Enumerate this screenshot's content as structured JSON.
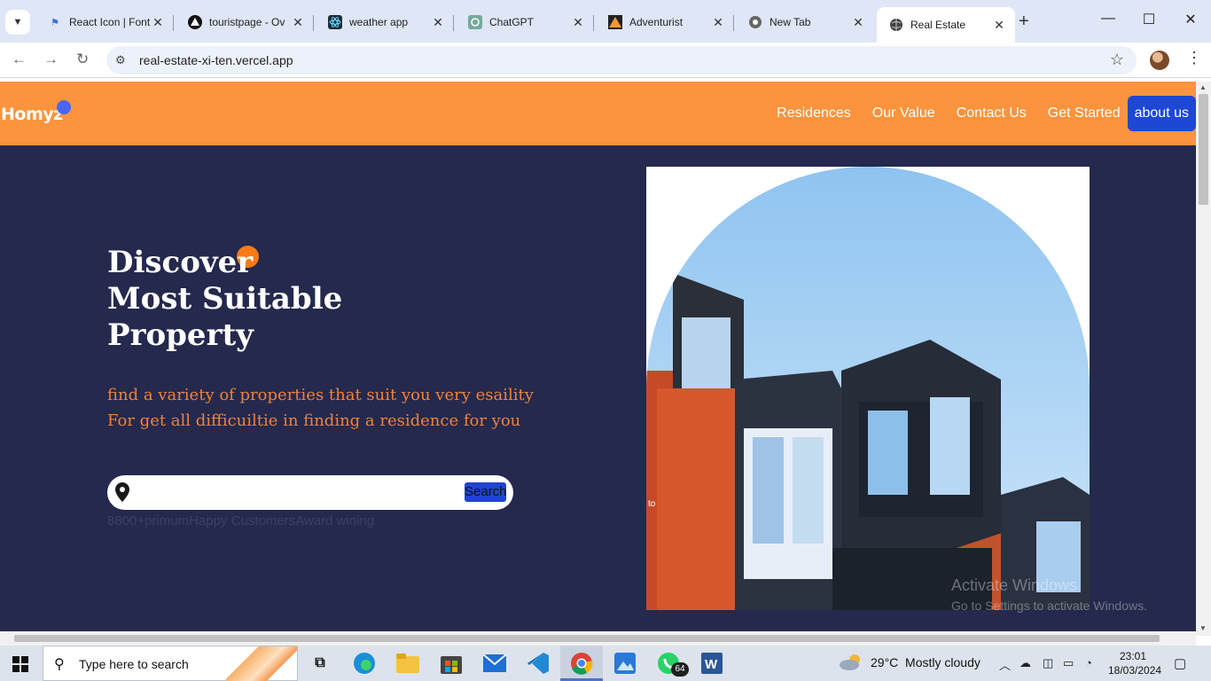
{
  "browser": {
    "tabs": [
      {
        "label": "React Icon | Font",
        "icon": "flag-icon",
        "active": false
      },
      {
        "label": "touristpage - Ov",
        "icon": "vercel-triangle-icon",
        "active": false
      },
      {
        "label": "weather app",
        "icon": "react-icon",
        "active": false
      },
      {
        "label": "ChatGPT",
        "icon": "chatgpt-icon",
        "active": false
      },
      {
        "label": "Adventurist",
        "icon": "mountain-icon",
        "active": false
      },
      {
        "label": "New Tab",
        "icon": "chrome-icon",
        "active": false
      },
      {
        "label": "Real Estate",
        "icon": "globe-icon",
        "active": true
      }
    ],
    "url": "real-estate-xi-ten.vercel.app"
  },
  "site": {
    "logo": "Homyz",
    "nav": {
      "residences": "Residences",
      "our_value": "Our Value",
      "contact_us": "Contact Us",
      "get_started": "Get Started",
      "about_us": "about us"
    },
    "hero": {
      "title_line1": "Discover",
      "title_line2": "Most Suitable",
      "title_line3": "Property",
      "subtitle_line1": "find a variety of properties that suit you very esaility",
      "subtitle_line2": "For get all difficuiltie in finding a residence for you",
      "search_button": "Search",
      "stats_text": "8800+primumHappy CustomersAward wining"
    },
    "image_caption": "to",
    "watermark": {
      "line1": "Activate Windows",
      "line2": "Go to Settings to activate Windows."
    },
    "colors": {
      "header": "#fb943c",
      "hero_bg": "#24294d",
      "accent_blue": "#1e48d4",
      "accent_orange": "#fb7a16"
    }
  },
  "taskbar": {
    "search_placeholder": "Type here to search",
    "whatsapp_badge": "64",
    "weather": "29°C  Mostly cloudy",
    "time": "23:01",
    "date": "18/03/2024"
  }
}
